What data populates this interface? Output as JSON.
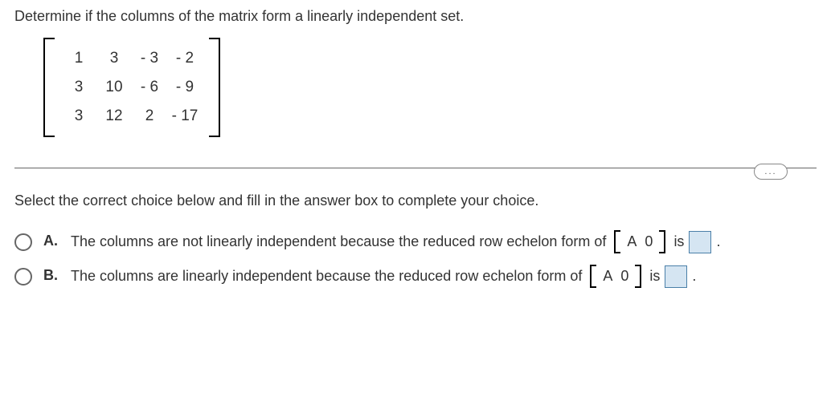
{
  "question": "Determine if the columns of the matrix form a linearly independent set.",
  "matrix": {
    "rows": [
      [
        "1",
        "3",
        "- 3",
        "- 2"
      ],
      [
        "3",
        "10",
        "- 6",
        "- 9"
      ],
      [
        "3",
        "12",
        "2",
        "- 17"
      ]
    ]
  },
  "ellipsis": "...",
  "select_prompt": "Select the correct choice below and fill in the answer box to complete your choice.",
  "choices": {
    "A": {
      "letter": "A.",
      "pre": "The columns are not linearly independent because the reduced row echelon form of",
      "mini_A": "A",
      "mini_0": "0",
      "mid": "is",
      "end": "."
    },
    "B": {
      "letter": "B.",
      "pre": "The columns are linearly independent because the reduced row echelon form of",
      "mini_A": "A",
      "mini_0": "0",
      "mid": "is",
      "end": "."
    }
  }
}
